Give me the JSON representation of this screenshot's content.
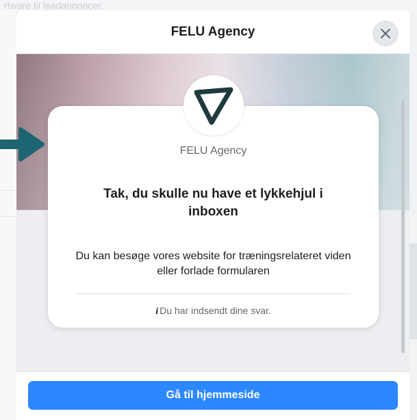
{
  "background": {
    "partial_text": "rtware til leadannoncer."
  },
  "dialog": {
    "title": "FELU Agency",
    "close_label": "×"
  },
  "card": {
    "brand_name": "FELU Agency",
    "headline": "Tak, du skulle nu have et lykkehjul i inboxen",
    "body": "Du kan besøge vores website for træningsrelateret viden eller forlade formularen",
    "info_icon": "i",
    "footnote": "Du har indsendt dine svar."
  },
  "footer": {
    "cta_label": "Gå til hjemmeside"
  },
  "colors": {
    "accent": "#2d88ff",
    "logo": "#1f3a3d",
    "arrow": "#1e6572"
  }
}
